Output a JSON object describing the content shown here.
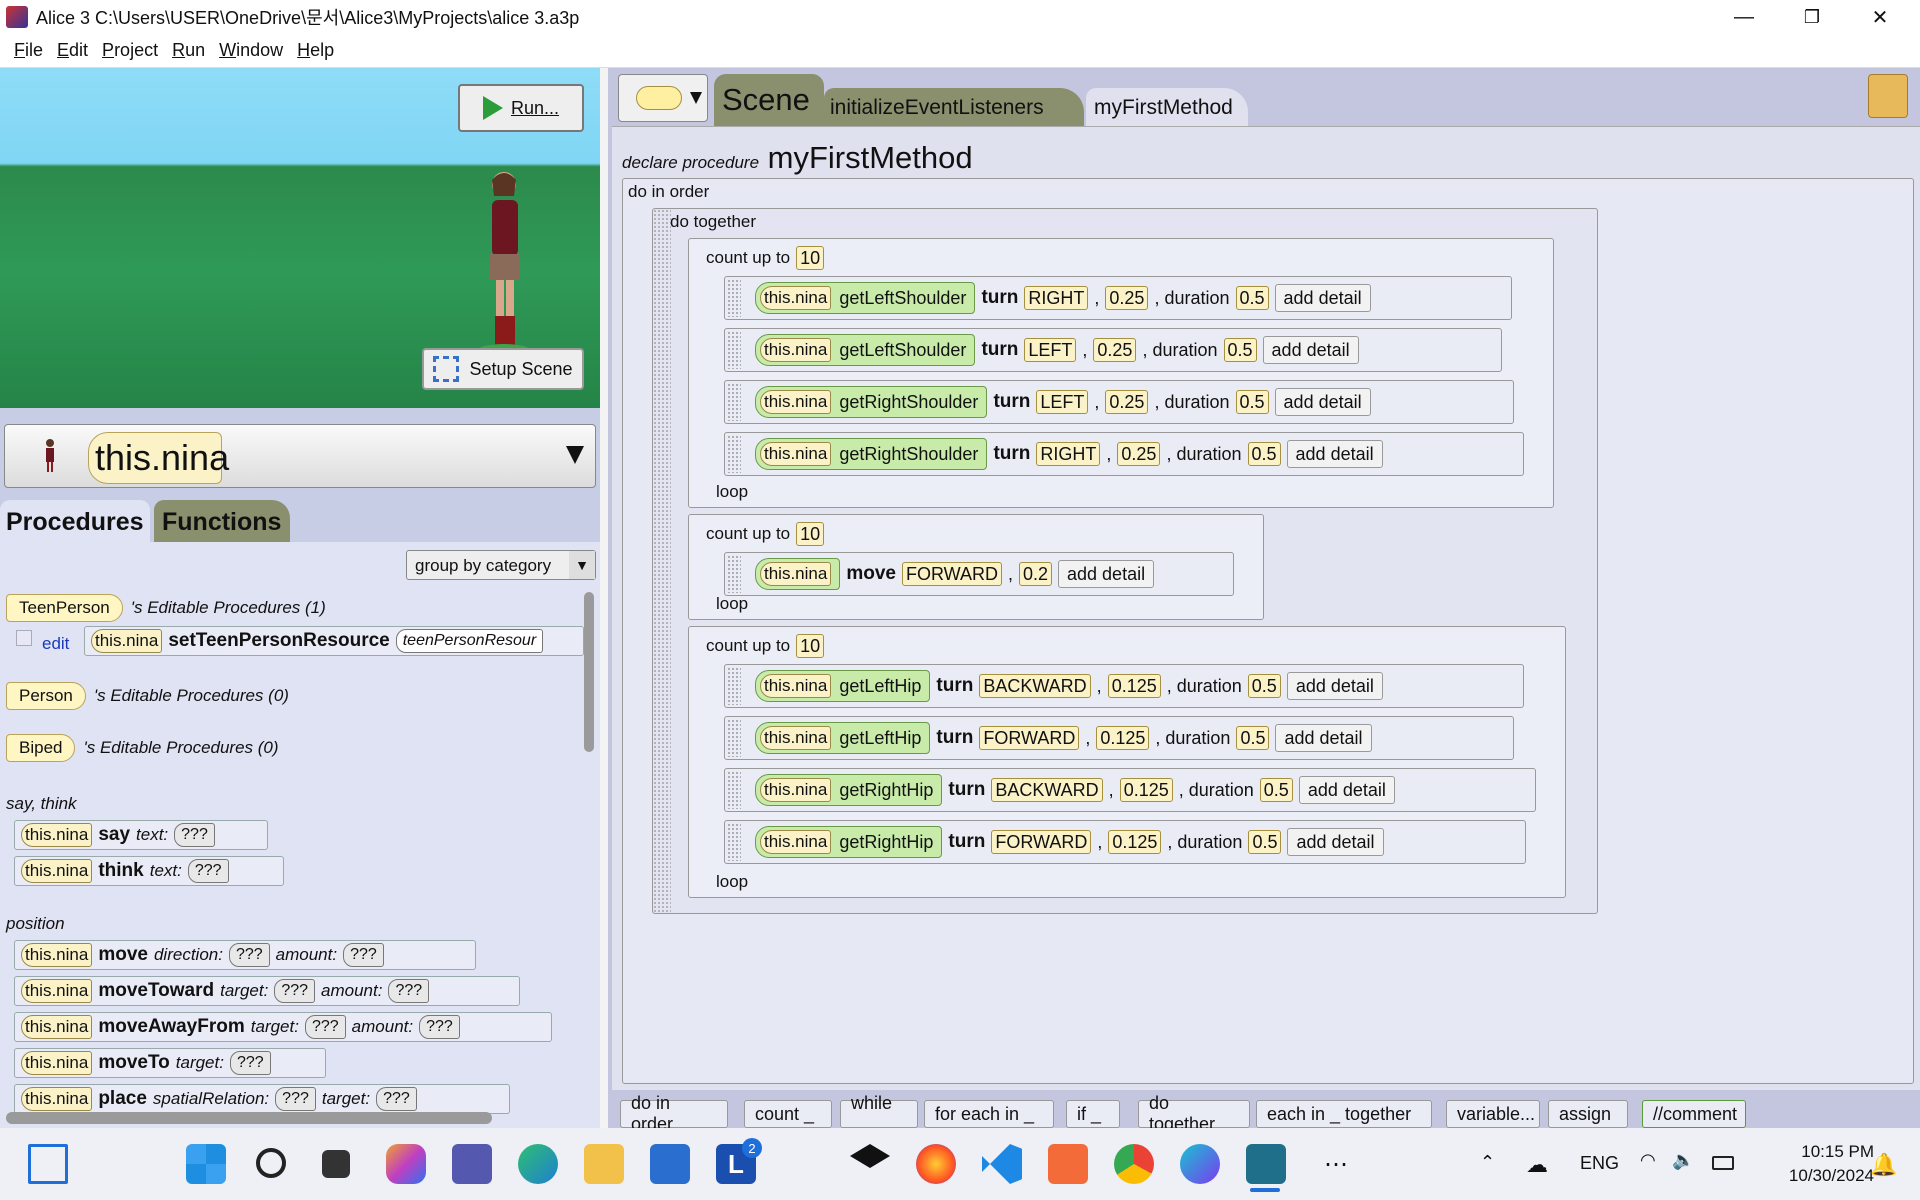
{
  "window": {
    "title": "Alice 3 C:\\Users\\USER\\OneDrive\\문서\\Alice3\\MyProjects\\alice 3.a3p",
    "minimize": "—",
    "maximize": "❐",
    "close": "✕"
  },
  "menu": [
    "File",
    "Edit",
    "Project",
    "Run",
    "Window",
    "Help"
  ],
  "scene": {
    "run_label": "Run...",
    "setup_label": "Setup Scene"
  },
  "selector": {
    "value": "this.nina"
  },
  "tabs": {
    "procedures": "Procedures",
    "functions": "Functions"
  },
  "group_by": "group by category",
  "editable": [
    {
      "type": "TeenPerson",
      "suffix": "'s Editable Procedures (1)"
    },
    {
      "type": "Person",
      "suffix": "'s Editable Procedures (0)"
    },
    {
      "type": "Biped",
      "suffix": "'s Editable Procedures (0)"
    }
  ],
  "edit_label": "edit",
  "set_resource": {
    "obj": "this.nina",
    "name": "setTeenPersonResource",
    "arg": "teenPersonResour"
  },
  "categories": {
    "saythink": "say, think",
    "position": "position"
  },
  "procs": [
    {
      "obj": "this.nina",
      "name": "say",
      "args": [
        {
          "label": "text:",
          "val": "???"
        }
      ]
    },
    {
      "obj": "this.nina",
      "name": "think",
      "args": [
        {
          "label": "text:",
          "val": "???"
        }
      ]
    },
    {
      "obj": "this.nina",
      "name": "move",
      "args": [
        {
          "label": "direction:",
          "val": "???"
        },
        {
          "label": "amount:",
          "val": "???"
        }
      ]
    },
    {
      "obj": "this.nina",
      "name": "moveToward",
      "args": [
        {
          "label": "target:",
          "val": "???"
        },
        {
          "label": "amount:",
          "val": "???"
        }
      ]
    },
    {
      "obj": "this.nina",
      "name": "moveAwayFrom",
      "args": [
        {
          "label": "target:",
          "val": "???"
        },
        {
          "label": "amount:",
          "val": "???"
        }
      ]
    },
    {
      "obj": "this.nina",
      "name": "moveTo",
      "args": [
        {
          "label": "target:",
          "val": "???"
        }
      ]
    },
    {
      "obj": "this.nina",
      "name": "place",
      "args": [
        {
          "label": "spatialRelation:",
          "val": "???"
        },
        {
          "label": "target:",
          "val": "???"
        }
      ]
    }
  ],
  "editor_tabs": {
    "scene": "Scene",
    "iel": "initializeEventListeners",
    "mfm": "myFirstMethod"
  },
  "declare": {
    "prefix": "declare procedure",
    "name": "myFirstMethod"
  },
  "code": {
    "do_in_order": "do in order",
    "do_together": "do together",
    "count_up_to": "count up to",
    "loop": "loop",
    "loops": [
      {
        "count": "10",
        "stmts": [
          {
            "obj": "this.nina",
            "joint": "getLeftShoulder",
            "verb": "turn",
            "dir": "RIGHT",
            "amt": "0.25",
            "dur": "0.5"
          },
          {
            "obj": "this.nina",
            "joint": "getLeftShoulder",
            "verb": "turn",
            "dir": "LEFT",
            "amt": "0.25",
            "dur": "0.5"
          },
          {
            "obj": "this.nina",
            "joint": "getRightShoulder",
            "verb": "turn",
            "dir": "LEFT",
            "amt": "0.25",
            "dur": "0.5"
          },
          {
            "obj": "this.nina",
            "joint": "getRightShoulder",
            "verb": "turn",
            "dir": "RIGHT",
            "amt": "0.25",
            "dur": "0.5"
          }
        ]
      },
      {
        "count": "10",
        "stmts": [
          {
            "obj": "this.nina",
            "joint": "",
            "verb": "move",
            "dir": "FORWARD",
            "amt": "0.2",
            "dur": ""
          }
        ]
      },
      {
        "count": "10",
        "stmts": [
          {
            "obj": "this.nina",
            "joint": "getLeftHip",
            "verb": "turn",
            "dir": "BACKWARD",
            "amt": "0.125",
            "dur": "0.5"
          },
          {
            "obj": "this.nina",
            "joint": "getLeftHip",
            "verb": "turn",
            "dir": "FORWARD",
            "amt": "0.125",
            "dur": "0.5"
          },
          {
            "obj": "this.nina",
            "joint": "getRightHip",
            "verb": "turn",
            "dir": "BACKWARD",
            "amt": "0.125",
            "dur": "0.5"
          },
          {
            "obj": "this.nina",
            "joint": "getRightHip",
            "verb": "turn",
            "dir": "FORWARD",
            "amt": "0.125",
            "dur": "0.5"
          }
        ]
      }
    ],
    "duration_label": ", duration",
    "add_detail": "add detail"
  },
  "palette": [
    "do in order",
    "count _",
    "while _",
    "for each in _",
    "if _",
    "do together",
    "each in _ together",
    "variable...",
    "assign",
    "//comment"
  ],
  "taskbar": {
    "lang": "ENG",
    "time": "10:15 PM",
    "date": "10/30/2024",
    "badge": "2"
  }
}
